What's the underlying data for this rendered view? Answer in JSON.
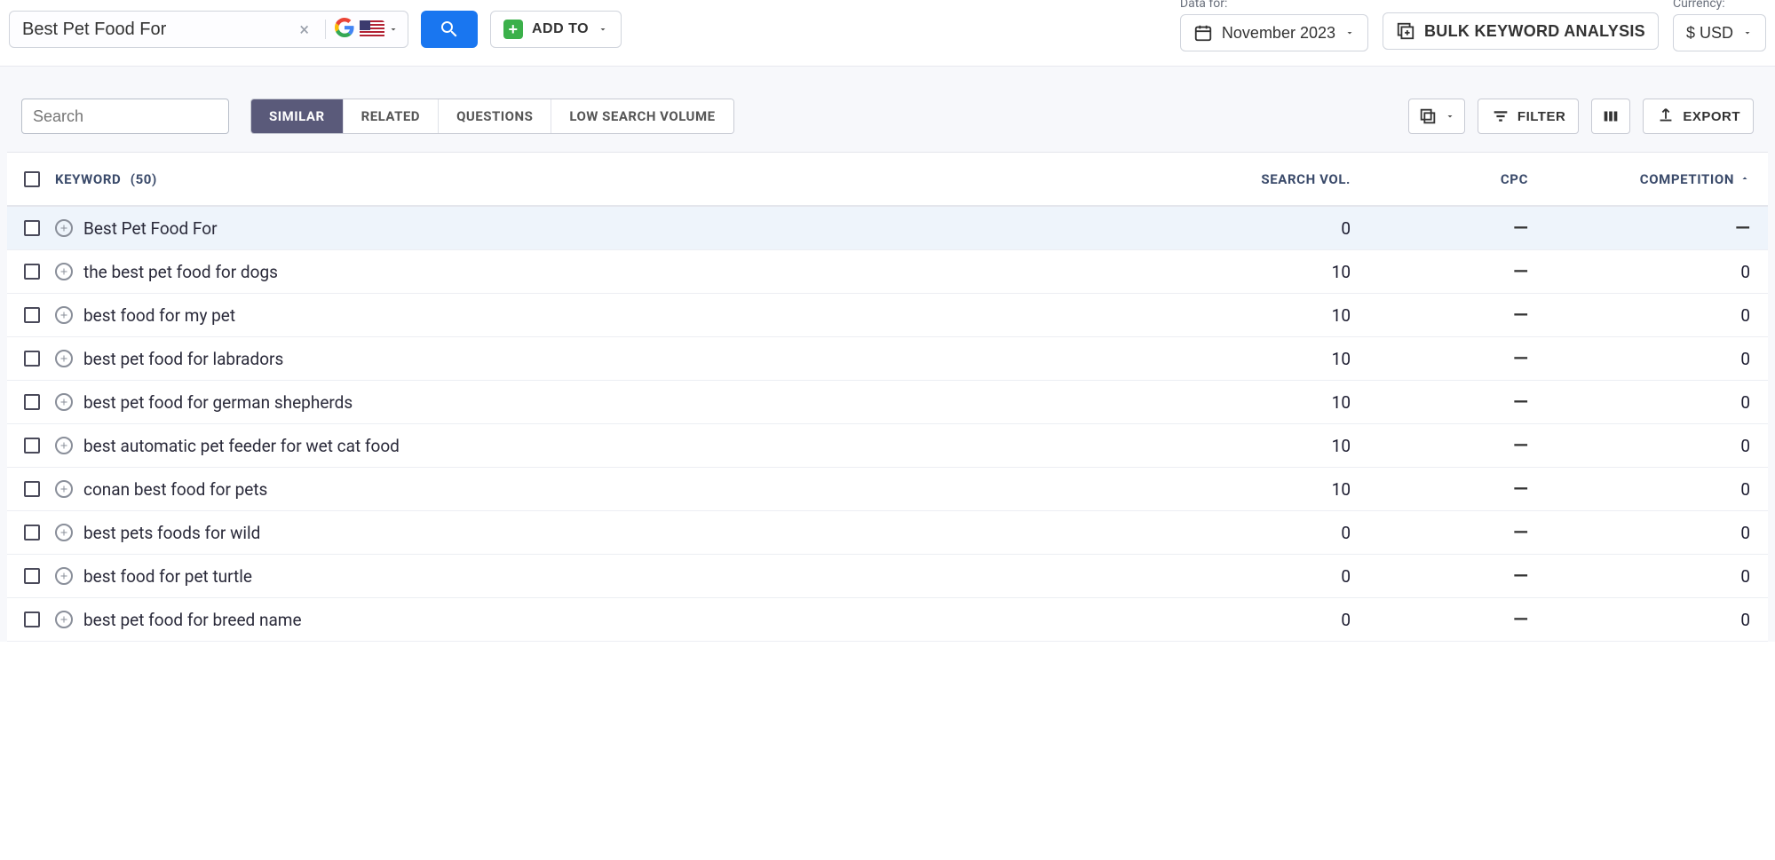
{
  "top": {
    "search_value": "Best Pet Food For",
    "addto_label": "ADD TO",
    "data_for_label": "Data for:",
    "date_label": "November 2023",
    "bulk_label": "BULK KEYWORD ANALYSIS",
    "currency_label": "Currency:",
    "currency_value": "$ USD"
  },
  "toolbar": {
    "search_placeholder": "Search",
    "tabs": [
      "SIMILAR",
      "RELATED",
      "QUESTIONS",
      "LOW SEARCH VOLUME"
    ],
    "active_tab": 0,
    "filter_label": "FILTER",
    "export_label": "EXPORT"
  },
  "table": {
    "header": {
      "keyword": "KEYWORD",
      "count": "(50)",
      "searchvol": "SEARCH VOL.",
      "cpc": "CPC",
      "competition": "COMPETITION"
    },
    "rows": [
      {
        "keyword": "Best Pet Food For",
        "vol": "0",
        "cpc": "—",
        "comp": "—",
        "highlight": true
      },
      {
        "keyword": "the best pet food for dogs",
        "vol": "10",
        "cpc": "—",
        "comp": "0"
      },
      {
        "keyword": "best food for my pet",
        "vol": "10",
        "cpc": "—",
        "comp": "0"
      },
      {
        "keyword": "best pet food for labradors",
        "vol": "10",
        "cpc": "—",
        "comp": "0"
      },
      {
        "keyword": "best pet food for german shepherds",
        "vol": "10",
        "cpc": "—",
        "comp": "0"
      },
      {
        "keyword": "best automatic pet feeder for wet cat food",
        "vol": "10",
        "cpc": "—",
        "comp": "0"
      },
      {
        "keyword": "conan best food for pets",
        "vol": "10",
        "cpc": "—",
        "comp": "0"
      },
      {
        "keyword": "best pets foods for wild",
        "vol": "0",
        "cpc": "—",
        "comp": "0"
      },
      {
        "keyword": "best food for pet turtle",
        "vol": "0",
        "cpc": "—",
        "comp": "0"
      },
      {
        "keyword": "best pet food for breed name",
        "vol": "0",
        "cpc": "—",
        "comp": "0"
      }
    ]
  }
}
